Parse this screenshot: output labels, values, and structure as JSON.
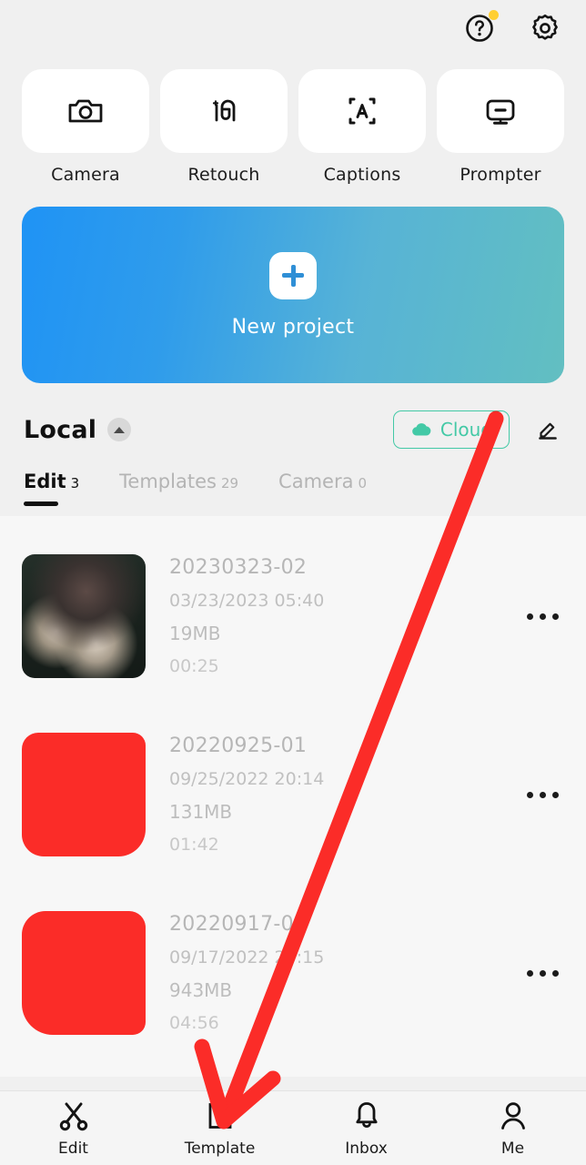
{
  "topbar": {
    "help": {
      "icon": "help-circle-icon",
      "has_badge": true,
      "badge_color": "#ffcf33"
    },
    "settings": {
      "icon": "gear-icon"
    }
  },
  "quick_actions": [
    {
      "label": "Camera",
      "icon": "camera-icon"
    },
    {
      "label": "Retouch",
      "icon": "retouch-face-sparkle-icon"
    },
    {
      "label": "Captions",
      "icon": "captions-scan-a-icon"
    },
    {
      "label": "Prompter",
      "icon": "monitor-prompter-icon"
    }
  ],
  "banner": {
    "label": "New project",
    "plus_icon": "plus-icon",
    "gradient_from": "#1f93f5",
    "gradient_to": "#62bfc1"
  },
  "section": {
    "title": "Local",
    "collapse_icon": "caret-up-icon",
    "cloud_button": {
      "label": "Cloud",
      "icon": "cloud-icon",
      "accent": "#43c9a6"
    },
    "edit_icon": "pencil-edit-icon"
  },
  "tabs": [
    {
      "label": "Edit",
      "count": "3",
      "active": true
    },
    {
      "label": "Templates",
      "count": "29",
      "active": false
    },
    {
      "label": "Camera",
      "count": "0",
      "active": false
    }
  ],
  "projects": [
    {
      "name": "20230323-02",
      "date": "03/23/2023 05:40",
      "size": "19MB",
      "duration": "00:25",
      "thumb": "photo"
    },
    {
      "name": "20220925-01",
      "date": "09/25/2022 20:14",
      "size": "131MB",
      "duration": "01:42",
      "thumb": "redacted"
    },
    {
      "name": "20220917-01",
      "date": "09/17/2022 20:15",
      "size": "943MB",
      "duration": "04:56",
      "thumb": "redacted"
    }
  ],
  "bottom_nav": [
    {
      "label": "Edit",
      "icon": "scissors-icon"
    },
    {
      "label": "Template",
      "icon": "film-play-icon"
    },
    {
      "label": "Inbox",
      "icon": "bell-icon"
    },
    {
      "label": "Me",
      "icon": "person-icon"
    }
  ],
  "annotation": {
    "color": "#fb2c28",
    "type": "arrow",
    "points_to": "Template"
  }
}
